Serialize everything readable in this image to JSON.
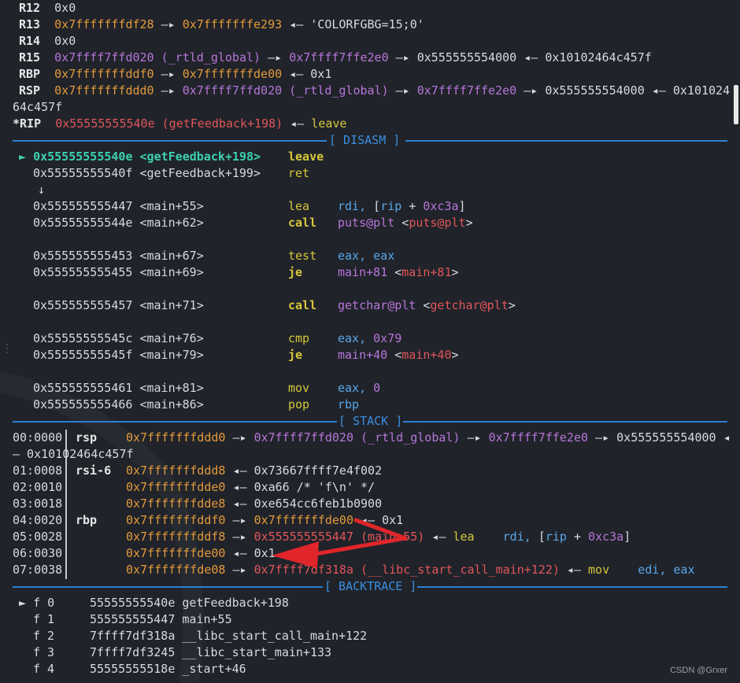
{
  "registers": {
    "r12": {
      "name": "R12",
      "value": "0x0"
    },
    "r13": {
      "name": "R13",
      "addr": "0x7fffffffdf28",
      "arrow": "—▸",
      "target": "0x7fffffffe293",
      "larrow": "◂—",
      "str": "'COLORFGBG=15;0'"
    },
    "r14": {
      "name": "R14",
      "value": "0x0"
    },
    "r15": {
      "name": "R15",
      "addr": "0x7ffff7ffd020 (_rtld_global)",
      "arrow": "—▸",
      "t1": "0x7ffff7ffe2e0",
      "arrow2": "—▸",
      "t2": "0x555555554000",
      "larrow": "◂—",
      "t3": "0x10102464c457f"
    },
    "rbp": {
      "name": "RBP",
      "addr": "0x7fffffffddf0",
      "arrow": "—▸",
      "t1": "0x7fffffffde00",
      "larrow": "◂—",
      "t2": "0x1"
    },
    "rsp": {
      "name": "RSP",
      "addr": "0x7fffffffddd0",
      "arrow": "—▸",
      "t1": "0x7ffff7ffd020 (_rtld_global)",
      "arrow2": "—▸",
      "t2": "0x7ffff7ffe2e0",
      "arrow3": "—▸",
      "t3": "0x555555554000",
      "larrow": "◂—",
      "t4": "0x101024",
      "wrap": "64c457f"
    },
    "rip": {
      "name": "*RIP",
      "addr": "0x55555555540e (getFeedback+198)",
      "larrow": "◂—",
      "instr": "leave"
    }
  },
  "sections": {
    "disasm": "[ DISASM ]",
    "stack": "[ STACK ]",
    "backtrace": "[ BACKTRACE ]"
  },
  "disasm": [
    {
      "marker": "►",
      "addr": "0x55555555540e",
      "sym": "<getFeedback+198>",
      "op": "leave",
      "args": ""
    },
    {
      "marker": "",
      "addr": "0x55555555540f",
      "sym": "<getFeedback+199>",
      "op": "ret",
      "args": ""
    },
    {
      "marker": "↓",
      "addr": "",
      "sym": "",
      "op": "",
      "args": ""
    },
    {
      "marker": "",
      "addr": "0x555555555447",
      "sym": "<main+55>",
      "op": "lea",
      "a1": "rdi,",
      "a2": "[rip",
      "a3": "+",
      "a4": "0xc3a]"
    },
    {
      "marker": "",
      "addr": "0x55555555544e",
      "sym": "<main+62>",
      "op": "call",
      "a1": "puts@plt",
      "a2": "<puts@plt>"
    },
    {
      "marker": "",
      "addr": "0x555555555453",
      "sym": "<main+67>",
      "op": "test",
      "a1": "eax,",
      "a2": "eax"
    },
    {
      "marker": "",
      "addr": "0x555555555455",
      "sym": "<main+69>",
      "op": "je",
      "a1": "main+81",
      "a2": "<main+81>"
    },
    {
      "marker": "",
      "addr": "0x555555555457",
      "sym": "<main+71>",
      "op": "call",
      "a1": "getchar@plt",
      "a2": "<getchar@plt>"
    },
    {
      "marker": "",
      "addr": "0x55555555545c",
      "sym": "<main+76>",
      "op": "cmp",
      "a1": "eax,",
      "a2": "0x79"
    },
    {
      "marker": "",
      "addr": "0x55555555545f",
      "sym": "<main+79>",
      "op": "je",
      "a1": "main+40",
      "a2": "<main+40>"
    },
    {
      "marker": "",
      "addr": "0x555555555461",
      "sym": "<main+81>",
      "op": "mov",
      "a1": "eax,",
      "a2": "0"
    },
    {
      "marker": "",
      "addr": "0x555555555466",
      "sym": "<main+86>",
      "op": "pop",
      "a1": "rbp",
      "a2": ""
    }
  ],
  "stack": [
    {
      "idx": "00:0000",
      "reg": "rsp",
      "addr": "0x7fffffffddd0",
      "arrow": "—▸",
      "t1": "0x7ffff7ffd020 (_rtld_global)",
      "arrow2": "—▸",
      "t2": "0x7ffff7ffe2e0",
      "arrow3": "—▸",
      "t3": "0x555555554000 ◂",
      "wrap": "— 0x10102464c457f"
    },
    {
      "idx": "01:0008",
      "reg": "rsi-6",
      "addr": "0x7fffffffddd8",
      "larrow": "◂—",
      "val": "0x73667ffff7e4f002"
    },
    {
      "idx": "02:0010",
      "reg": "",
      "addr": "0x7fffffffdde0",
      "larrow": "◂—",
      "val": "0xa66 /* 'f\\n' */"
    },
    {
      "idx": "03:0018",
      "reg": "",
      "addr": "0x7fffffffdde8",
      "larrow": "◂—",
      "val": "0xe654cc6feb1b0900"
    },
    {
      "idx": "04:0020",
      "reg": "rbp",
      "addr": "0x7fffffffddf0",
      "arrow": "—▸",
      "t1": "0x7fffffffde00",
      "larrow": "◂—",
      "val": "0x1"
    },
    {
      "idx": "05:0028",
      "reg": "",
      "addr": "0x7fffffffddf8",
      "arrow": "—▸",
      "t1": "0x555555555447 (main+55)",
      "larrow": "◂—",
      "op": "lea",
      "a1": "rdi,",
      "a2": "[rip",
      "a3": "+",
      "a4": "0xc3a]"
    },
    {
      "idx": "06:0030",
      "reg": "",
      "addr": "0x7fffffffde00",
      "larrow": "◂—",
      "val": "0x1"
    },
    {
      "idx": "07:0038",
      "reg": "",
      "addr": "0x7fffffffde08",
      "arrow": "—▸",
      "t1": "0x7ffff7df318a (__libc_start_call_main+122)",
      "larrow": "◂—",
      "op": "mov",
      "a1": "edi,",
      "a2": "eax"
    }
  ],
  "backtrace": [
    {
      "marker": "►",
      "frame": "f 0",
      "addr": "55555555540e",
      "sym": "getFeedback+198"
    },
    {
      "marker": "",
      "frame": "f 1",
      "addr": "555555555447",
      "sym": "main+55"
    },
    {
      "marker": "",
      "frame": "f 2",
      "addr": "7ffff7df318a",
      "sym": "__libc_start_call_main+122"
    },
    {
      "marker": "",
      "frame": "f 3",
      "addr": "7ffff7df3245",
      "sym": "__libc_start_main+133"
    },
    {
      "marker": "",
      "frame": "f 4",
      "addr": "55555555518e",
      "sym": "_start+46"
    }
  ],
  "watermark": "CSDN @Grxer",
  "colors": {
    "background": "#20232a",
    "section_rule": "#2d7fd0",
    "annotation_arrow": "#e0262a"
  }
}
